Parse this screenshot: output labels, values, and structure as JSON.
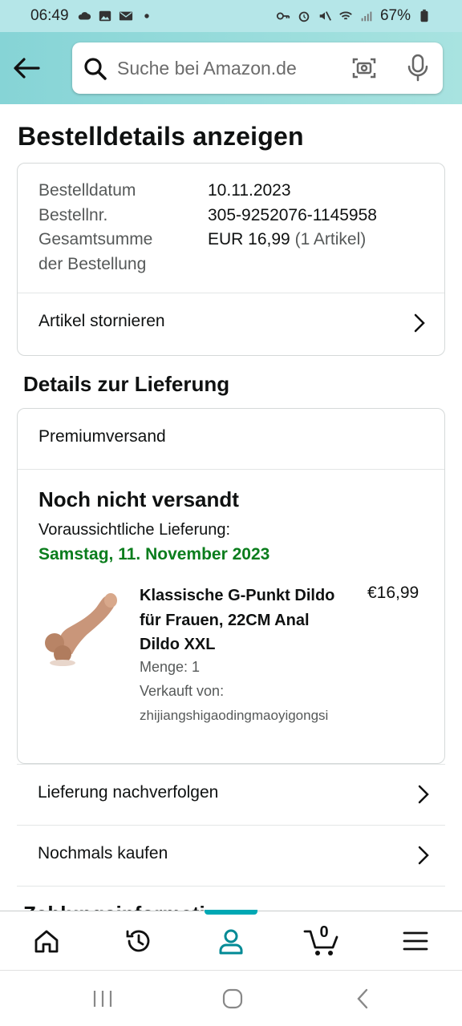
{
  "status_bar": {
    "time": "06:49",
    "battery": "67%"
  },
  "search": {
    "placeholder": "Suche bei Amazon.de"
  },
  "page": {
    "title": "Bestelldetails anzeigen"
  },
  "order": {
    "date_label": "Bestelldatum",
    "date_value": "10.11.2023",
    "number_label": "Bestellnr.",
    "number_value": "305-9252076-1145958",
    "total_label_line1": "Gesamtsumme",
    "total_label_line2": "der Bestellung",
    "total_value": "EUR 16,99",
    "total_count": "(1 Artikel)",
    "cancel_label": "Artikel stornieren"
  },
  "delivery": {
    "section_title": "Details zur Lieferung",
    "shipping_method": "Premiumversand",
    "status": "Noch nicht versandt",
    "eta_label": "Voraussichtliche Lieferung:",
    "eta_date": "Samstag, 11. November 2023",
    "product": {
      "title": "Klassische G-Punkt Dildo für Frauen, 22CM Anal Dildo XXL",
      "price": "€16,99",
      "quantity": "Menge: 1",
      "seller_label": "Verkauft von:",
      "seller": "zhijiangshigaodingmaoyigongsi"
    }
  },
  "actions": {
    "track": "Lieferung nachverfolgen",
    "buy_again": "Nochmals kaufen"
  },
  "peek_section": "Zahlungsinformationen",
  "bottom_nav": {
    "cart_count": "0",
    "active": "account"
  },
  "colors": {
    "header": "#a8e3e0",
    "accent": "#00a8b4",
    "eta_green": "#0b7d1d"
  }
}
